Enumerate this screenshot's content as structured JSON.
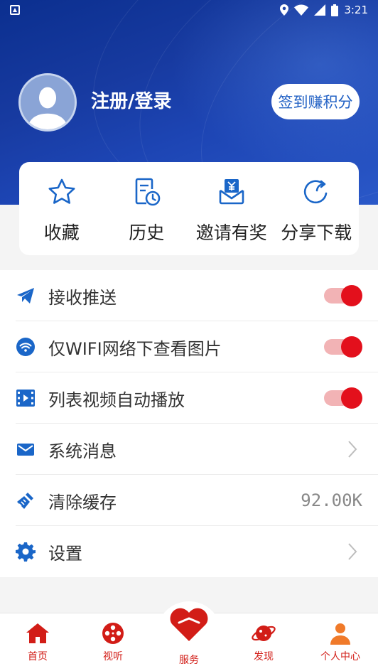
{
  "status_bar": {
    "time": "3:21"
  },
  "profile": {
    "login_text": "注册/登录",
    "checkin_label": "签到赚积分"
  },
  "quick_actions": [
    {
      "label": "收藏",
      "icon": "star-icon"
    },
    {
      "label": "历史",
      "icon": "history-icon"
    },
    {
      "label": "邀请有奖",
      "icon": "invite-reward-icon"
    },
    {
      "label": "分享下载",
      "icon": "share-icon"
    }
  ],
  "settings": [
    {
      "label": "接收推送",
      "icon": "send-icon",
      "toggle": true
    },
    {
      "label": "仅WIFI网络下查看图片",
      "icon": "wifi-icon",
      "toggle": true
    },
    {
      "label": "列表视频自动播放",
      "icon": "video-icon",
      "toggle": true
    },
    {
      "label": "系统消息",
      "icon": "mail-icon"
    },
    {
      "label": "清除缓存",
      "icon": "broom-icon",
      "value": "92.00K"
    },
    {
      "label": "设置",
      "icon": "gear-icon"
    }
  ],
  "tabbar": [
    {
      "label": "首页",
      "icon": "home-icon"
    },
    {
      "label": "视听",
      "icon": "film-reel-icon"
    },
    {
      "label": "服务",
      "icon": "heart-icon"
    },
    {
      "label": "发现",
      "icon": "planet-icon"
    },
    {
      "label": "个人中心",
      "icon": "person-icon"
    }
  ],
  "colors": {
    "header_blue": "#173aa0",
    "accent_red": "#d21d17",
    "icon_blue": "#1a66c8",
    "toggle_on": "#e3101c"
  }
}
